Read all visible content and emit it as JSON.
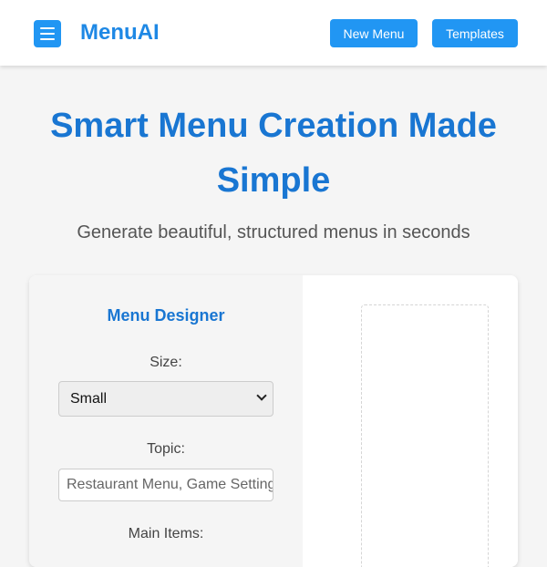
{
  "header": {
    "brand": "MenuAI",
    "new_menu_label": "New Menu",
    "templates_label": "Templates",
    "accent_color": "#2196f3"
  },
  "hero": {
    "title": "Smart Menu Creation Made Simple",
    "subtitle": "Generate beautiful, structured menus in seconds"
  },
  "designer": {
    "title": "Menu Designer",
    "size_label": "Size:",
    "size_value": "Small",
    "topic_label": "Topic:",
    "topic_placeholder": "Restaurant Menu, Game Settings",
    "main_items_label": "Main Items:"
  },
  "icons": {
    "menu": "hamburger-icon",
    "select": "chevron-down-icon"
  }
}
